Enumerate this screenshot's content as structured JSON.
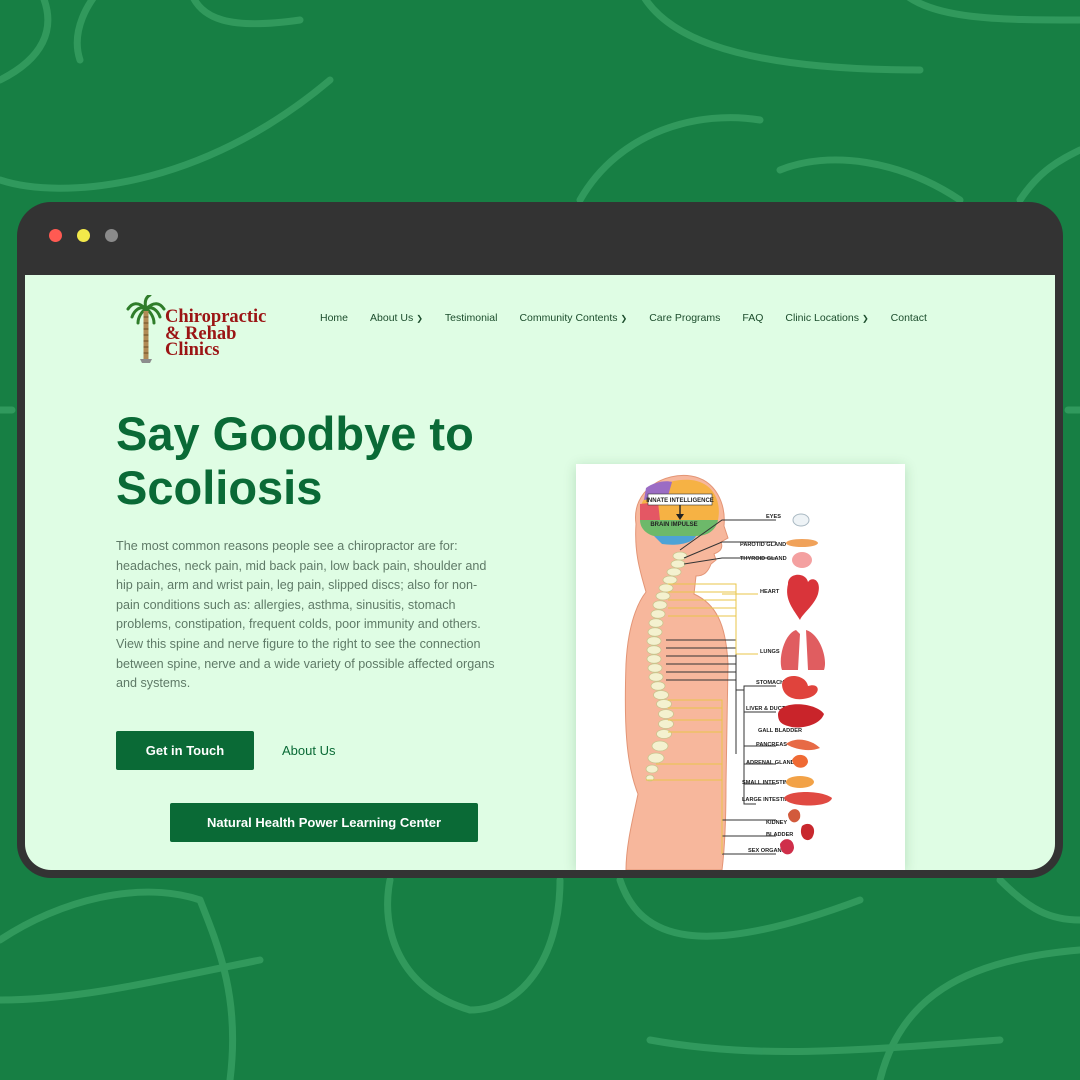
{
  "logo": {
    "line1": "Chiropractic",
    "line2": "& Rehab",
    "line3": "Clinics"
  },
  "nav": {
    "items": [
      {
        "label": "Home",
        "dropdown": false
      },
      {
        "label": "About Us",
        "dropdown": true
      },
      {
        "label": "Testimonial",
        "dropdown": false
      },
      {
        "label": "Community Contents",
        "dropdown": true
      },
      {
        "label": "Care Programs",
        "dropdown": false
      },
      {
        "label": "FAQ",
        "dropdown": false
      },
      {
        "label": "Clinic Locations",
        "dropdown": true
      },
      {
        "label": "Contact",
        "dropdown": false
      }
    ]
  },
  "hero": {
    "title_line1": "Say Goodbye to",
    "title_line2": "Scoliosis",
    "body": "The most common reasons people see a chiropractor are for: headaches, neck pain, mid back pain, low back pain, shoulder and hip pain, arm and wrist pain, leg pain, slipped discs; also for non-pain conditions such as: allergies, asthma, sinusitis, stomach problems, constipation, frequent colds, poor immunity and others. View this spine and nerve figure to the right to see the connection between spine, nerve and a wide variety of possible affected organs and systems.",
    "primary_button": "Get in Touch",
    "secondary_link": "About Us",
    "learning_button": "Natural Health Power Learning Center"
  },
  "figure": {
    "brain_top": "INNATE INTELLIGENCE",
    "brain_bottom": "BRAIN IMPULSE",
    "organs": {
      "eyes": "EYES",
      "parotid": "PAROTID GLAND",
      "thyroid": "THYROID GLAND",
      "heart": "HEART",
      "lungs": "LUNGS",
      "stomach": "STOMACH",
      "liver": "LIVER & DUCTS",
      "gallbladder": "GALL BLADDER",
      "pancreas": "PANCREAS",
      "adrenal": "ADRENAL GLAND",
      "small_intestine": "SMALL INTESTINE",
      "large_intestine": "LARGE INTESTINE",
      "kidney": "KIDNEY",
      "bladder": "BLADDER",
      "sex_organs": "SEX ORGANS"
    }
  },
  "colors": {
    "page_background": "#177f44",
    "browser_frame": "#333333",
    "viewport_background": "#dffde4",
    "brand_green": "#0a6a36",
    "logo_red": "#9b1414"
  },
  "icons": {
    "window_controls": [
      "close-dot",
      "minimize-dot",
      "maximize-dot"
    ],
    "dropdown": "chevron-down-icon",
    "logo": "palm-tree-icon"
  }
}
